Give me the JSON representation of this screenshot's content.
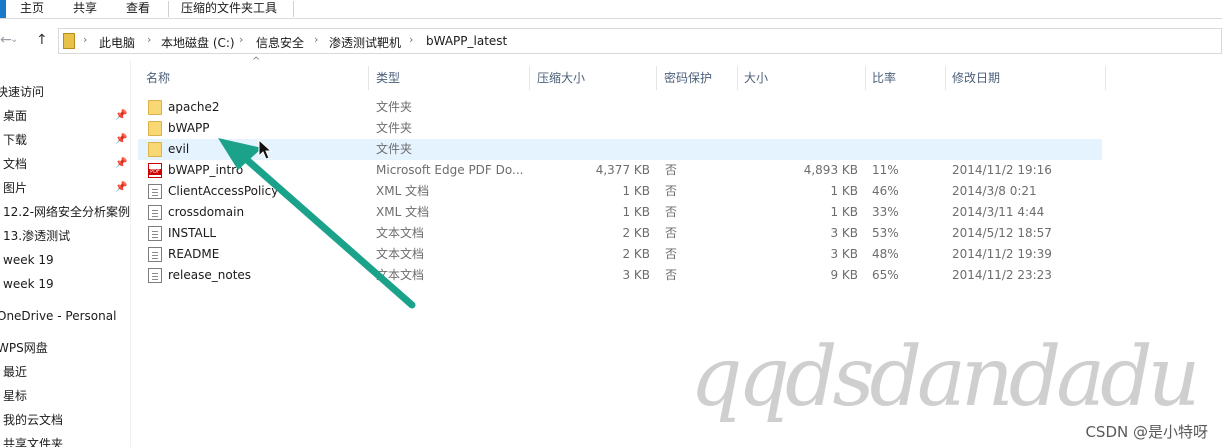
{
  "ribbon": {
    "tabs": [
      {
        "label": "主页"
      },
      {
        "label": "共享"
      },
      {
        "label": "查看"
      },
      {
        "label": "压缩的文件夹工具"
      }
    ]
  },
  "nav": {
    "back_icon": "back-arrow-icon",
    "forward_icon": "forward-arrow-icon",
    "dropdown_icon": "chevron-down-icon",
    "up_icon": "up-arrow-icon"
  },
  "breadcrumb": [
    {
      "label": "此电脑"
    },
    {
      "label": "本地磁盘 (C:)"
    },
    {
      "label": "信息安全"
    },
    {
      "label": "渗透测试靶机"
    },
    {
      "label": "bWAPP_latest"
    }
  ],
  "sidebar": {
    "items": [
      {
        "label": "快速访问",
        "pinned": false
      },
      {
        "label": "桌面",
        "pinned": true
      },
      {
        "label": "下载",
        "pinned": true
      },
      {
        "label": "文档",
        "pinned": true
      },
      {
        "label": "图片",
        "pinned": true
      },
      {
        "label": "12.2-网络安全分析案例",
        "pinned": false
      },
      {
        "label": "13.渗透测试",
        "pinned": false
      },
      {
        "label": "week  19",
        "pinned": false
      },
      {
        "label": "week 19",
        "pinned": false
      },
      {
        "label": "OneDrive - Personal",
        "pinned": false
      },
      {
        "label": "WPS网盘",
        "pinned": false
      },
      {
        "label": "最近",
        "pinned": false
      },
      {
        "label": "星标",
        "pinned": false
      },
      {
        "label": "我的云文档",
        "pinned": false
      },
      {
        "label": "共享文件夹",
        "pinned": false
      }
    ]
  },
  "columns": {
    "name": "名称",
    "type": "类型",
    "compressed_size": "压缩大小",
    "password": "密码保护",
    "size": "大小",
    "ratio": "比率",
    "modified": "修改日期"
  },
  "files": [
    {
      "name": "apache2",
      "icon": "folder-icon",
      "type": "文件夹",
      "compressed": "",
      "password": "",
      "size": "",
      "ratio": "",
      "date": ""
    },
    {
      "name": "bWAPP",
      "icon": "folder-icon",
      "type": "文件夹",
      "compressed": "",
      "password": "",
      "size": "",
      "ratio": "",
      "date": ""
    },
    {
      "name": "evil",
      "icon": "folder-icon",
      "type": "文件夹",
      "compressed": "",
      "password": "",
      "size": "",
      "ratio": "",
      "date": ""
    },
    {
      "name": "bWAPP_intro",
      "icon": "pdf-icon",
      "type": "Microsoft Edge PDF Do...",
      "compressed": "4,377 KB",
      "password": "否",
      "size": "4,893 KB",
      "ratio": "11%",
      "date": "2014/11/2 19:16"
    },
    {
      "name": "ClientAccessPolicy",
      "icon": "xml-file-icon",
      "type": "XML 文档",
      "compressed": "1 KB",
      "password": "否",
      "size": "1 KB",
      "ratio": "46%",
      "date": "2014/3/8 0:21"
    },
    {
      "name": "crossdomain",
      "icon": "xml-file-icon",
      "type": "XML 文档",
      "compressed": "1 KB",
      "password": "否",
      "size": "1 KB",
      "ratio": "33%",
      "date": "2014/3/11 4:44"
    },
    {
      "name": "INSTALL",
      "icon": "text-file-icon",
      "type": "文本文档",
      "compressed": "2 KB",
      "password": "否",
      "size": "3 KB",
      "ratio": "53%",
      "date": "2014/5/12 18:57"
    },
    {
      "name": "README",
      "icon": "text-file-icon",
      "type": "文本文档",
      "compressed": "2 KB",
      "password": "否",
      "size": "3 KB",
      "ratio": "48%",
      "date": "2014/11/2 19:39"
    },
    {
      "name": "release_notes",
      "icon": "text-file-icon",
      "type": "文本文档",
      "compressed": "3 KB",
      "password": "否",
      "size": "9 KB",
      "ratio": "65%",
      "date": "2014/11/2 23:23"
    }
  ],
  "hover_row": "evil",
  "annotation": {
    "arrow_color": "#1aa38a"
  },
  "watermark": {
    "text": "qqdsdandadu"
  },
  "footer": {
    "csdn_credit": "CSDN @是小特呀"
  },
  "colors": {
    "folder": "#f8d775",
    "hover": "#e5f3ff",
    "header_text": "#4c607a",
    "accent": "#1979ca"
  }
}
